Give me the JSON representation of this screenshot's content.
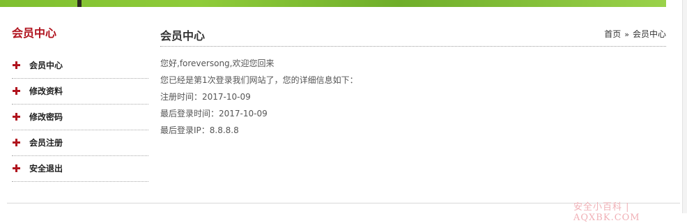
{
  "sidebar": {
    "title": "会员中心",
    "items": [
      {
        "label": "会员中心"
      },
      {
        "label": "修改资料"
      },
      {
        "label": "修改密码"
      },
      {
        "label": "会员注册"
      },
      {
        "label": "安全退出"
      }
    ]
  },
  "main": {
    "title": "会员中心",
    "breadcrumb": {
      "home": "首页",
      "separator": "»",
      "current": "会员中心"
    },
    "info": {
      "greeting": "您好,foreversong,欢迎您回来",
      "visit_line": "您已经是第1次登录我们网站了，您的详细信息如下：",
      "register_time": "注册时间：2017-10-09",
      "last_login_time": "最后登录时间：2017-10-09",
      "last_login_ip": "最后登录IP：8.8.8.8"
    }
  },
  "watermark": "安全小百科 | AQXBK.COM",
  "colors": {
    "accent": "#b0121d",
    "banner": "#8fcc3a"
  },
  "icons": {
    "list_marker": "plus-icon"
  }
}
